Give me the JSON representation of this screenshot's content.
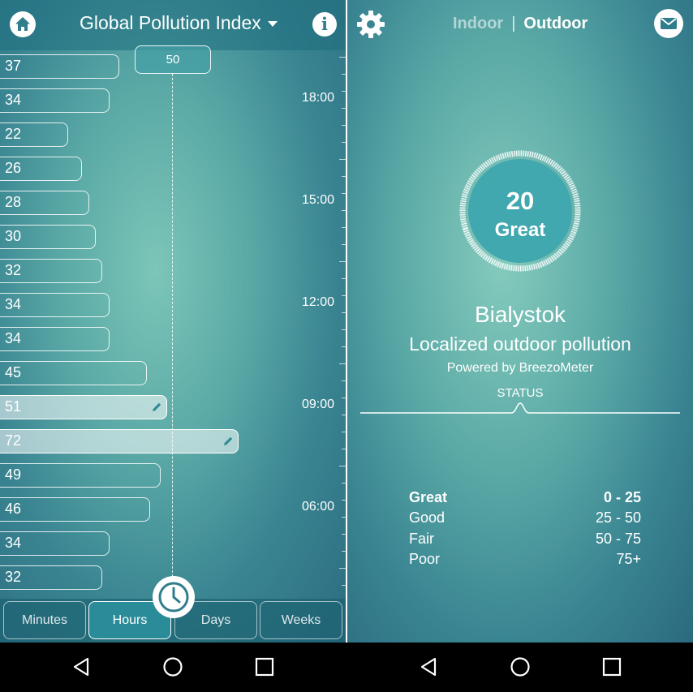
{
  "left": {
    "title": "Global Pollution Index",
    "threshold": "50",
    "bars": [
      {
        "value": "37",
        "level": 37
      },
      {
        "value": "34",
        "level": 34
      },
      {
        "value": "22",
        "level": 22
      },
      {
        "value": "26",
        "level": 26
      },
      {
        "value": "28",
        "level": 28
      },
      {
        "value": "30",
        "level": 30
      },
      {
        "value": "32",
        "level": 32
      },
      {
        "value": "34",
        "level": 34
      },
      {
        "value": "34",
        "level": 34
      },
      {
        "value": "45",
        "level": 45
      },
      {
        "value": "51",
        "level": 51,
        "highlight": true
      },
      {
        "value": "72",
        "level": 72,
        "highlight": true
      },
      {
        "value": "49",
        "level": 49
      },
      {
        "value": "46",
        "level": 46
      },
      {
        "value": "34",
        "level": 34
      },
      {
        "value": "32",
        "level": 32
      }
    ],
    "time_labels": [
      "18:00",
      "15:00",
      "12:00",
      "09:00",
      "06:00"
    ],
    "tabs": [
      "Minutes",
      "Hours",
      "Days",
      "Weeks"
    ],
    "active_tab": "Hours"
  },
  "right": {
    "mode_inactive": "Indoor",
    "mode_separator": "|",
    "mode_active": "Outdoor",
    "aqi_value": "20",
    "aqi_category": "Great",
    "city": "Bialystok",
    "subtitle": "Localized outdoor pollution",
    "powered_by": "Powered by BreezoMeter",
    "status_label": "STATUS",
    "legend": [
      {
        "label": "Great",
        "range": "0 - 25",
        "bold": true
      },
      {
        "label": "Good",
        "range": "25 - 50"
      },
      {
        "label": "Fair",
        "range": "50 - 75"
      },
      {
        "label": "Poor",
        "range": "75+"
      }
    ]
  },
  "colors": {
    "accent": "#2a8c99",
    "gauge_fill": "#42a8b0"
  },
  "icons": [
    "home-icon",
    "info-icon",
    "clock-icon",
    "pencil-icon",
    "gear-icon",
    "mail-icon",
    "back-icon",
    "home-circle-icon",
    "recents-icon"
  ]
}
